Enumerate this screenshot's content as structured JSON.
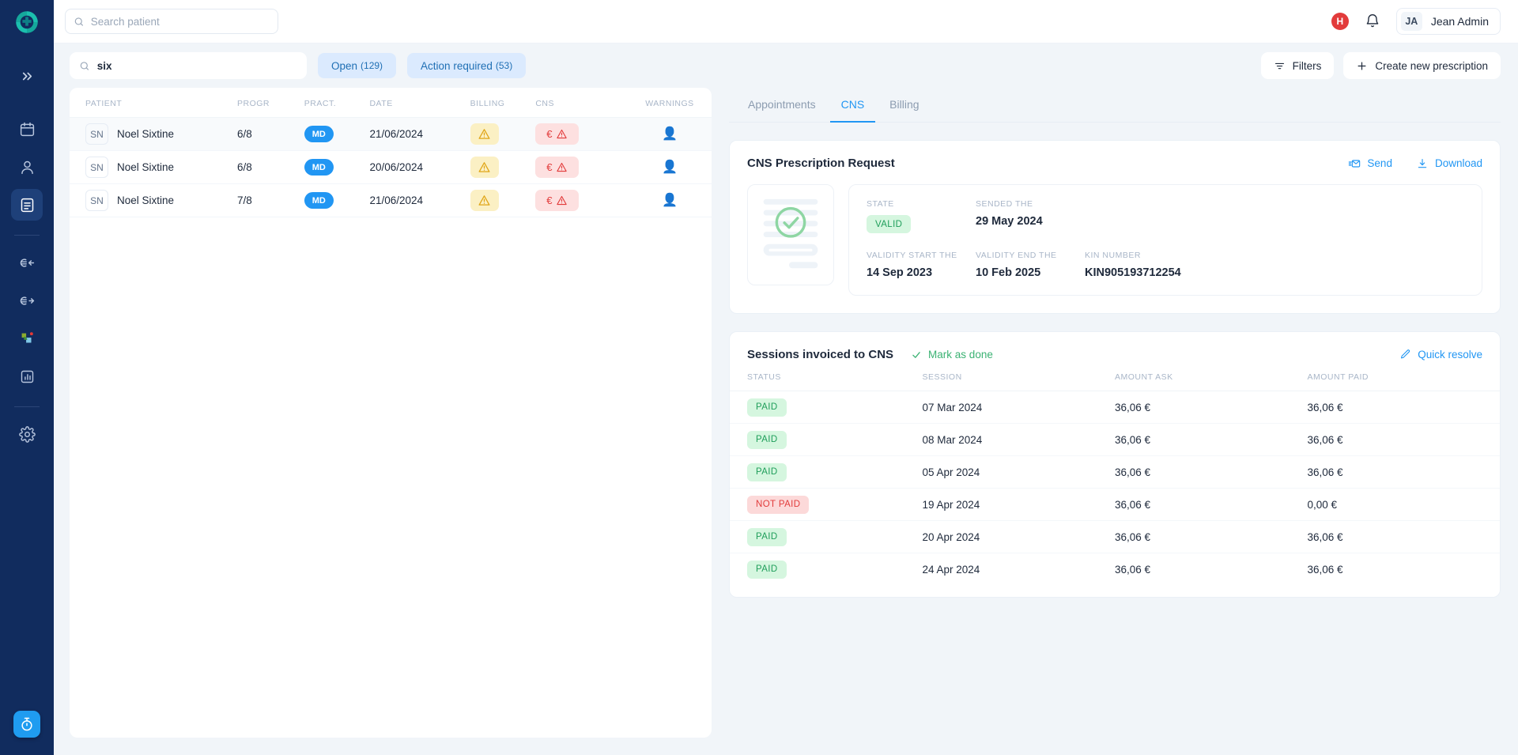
{
  "sidebar": {
    "logo_icon": "medical-cross-logo",
    "collapse_icon": "chevrons-right-icon",
    "items": [
      {
        "name": "calendar",
        "icon": "calendar-icon",
        "active": false
      },
      {
        "name": "patients",
        "icon": "user-icon",
        "active": false
      },
      {
        "name": "prescriptions",
        "icon": "document-lines-icon",
        "active": true
      },
      {
        "name": "incoming-payments",
        "icon": "euro-arrow-left-icon",
        "active": false
      },
      {
        "name": "outgoing-payments",
        "icon": "euro-arrow-right-icon",
        "active": false
      },
      {
        "name": "apps",
        "icon": "colored-shapes-icon",
        "active": false
      },
      {
        "name": "statistics",
        "icon": "bar-chart-icon",
        "active": false
      },
      {
        "name": "settings",
        "icon": "gear-icon",
        "active": false
      }
    ],
    "timer_icon": "stopwatch-icon"
  },
  "topbar": {
    "search_placeholder": "Search patient",
    "search_value": "",
    "search_icon": "search-icon",
    "alert_letter": "H",
    "bell_icon": "bell-icon",
    "user_initials": "JA",
    "user_name": "Jean Admin"
  },
  "subbar": {
    "search_value": "six",
    "search_placeholder": "Search",
    "search_icon": "search-icon",
    "tabs": [
      {
        "label": "Open",
        "count": "(129)"
      },
      {
        "label": "Action required",
        "count": "(53)"
      }
    ],
    "filters_label": "Filters",
    "filters_icon": "filter-icon",
    "create_label": "Create new prescription",
    "create_icon": "plus-icon"
  },
  "patient_table": {
    "headers": [
      "PATIENT",
      "PROGR",
      "PRACT.",
      "DATE",
      "BILLING",
      "CNS",
      "WARNINGS"
    ],
    "rows": [
      {
        "initials": "SN",
        "name": "Noel Sixtine",
        "progr": "6/8",
        "pract": "MD",
        "date": "21/06/2024",
        "billing_icon": "warning-triangle-icon",
        "cns_icon": "euro-warning-icon",
        "warning_icon": "person-warning-icon",
        "active": true
      },
      {
        "initials": "SN",
        "name": "Noel Sixtine",
        "progr": "6/8",
        "pract": "MD",
        "date": "20/06/2024",
        "billing_icon": "warning-triangle-icon",
        "cns_icon": "euro-warning-icon",
        "warning_icon": "person-warning-icon",
        "active": false
      },
      {
        "initials": "SN",
        "name": "Noel Sixtine",
        "progr": "7/8",
        "pract": "MD",
        "date": "21/06/2024",
        "billing_icon": "warning-triangle-icon",
        "cns_icon": "euro-warning-icon",
        "warning_icon": "person-warning-icon",
        "active": false
      }
    ]
  },
  "detail": {
    "tabs": [
      {
        "label": "Appointments",
        "active": false
      },
      {
        "label": "CNS",
        "active": true
      },
      {
        "label": "Billing",
        "active": false
      }
    ],
    "prescription": {
      "title": "CNS Prescription Request",
      "send_label": "Send",
      "send_icon": "send-envelope-icon",
      "download_label": "Download",
      "download_icon": "download-icon",
      "thumbnail_icon": "document-check-icon",
      "state_label": "STATE",
      "state_value": "VALID",
      "sent_label": "SENDED THE",
      "sent_value": "29 May 2024",
      "validity_start_label": "VALIDITY START THE",
      "validity_start_value": "14 Sep 2023",
      "validity_end_label": "VALIDITY END THE",
      "validity_end_value": "10 Feb 2025",
      "kin_label": "KIN NUMBER",
      "kin_value": "KIN905193712254"
    },
    "sessions": {
      "title": "Sessions invoiced to CNS",
      "mark_done_label": "Mark as done",
      "mark_done_icon": "check-icon",
      "quick_resolve_label": "Quick resolve",
      "quick_resolve_icon": "pencil-icon",
      "headers": [
        "STATUS",
        "SESSION",
        "AMOUNT ASK",
        "AMOUNT PAID"
      ],
      "rows": [
        {
          "status": "PAID",
          "paid": true,
          "session": "07 Mar 2024",
          "amount_ask": "36,06 €",
          "amount_paid": "36,06 €"
        },
        {
          "status": "PAID",
          "paid": true,
          "session": "08 Mar 2024",
          "amount_ask": "36,06 €",
          "amount_paid": "36,06 €"
        },
        {
          "status": "PAID",
          "paid": true,
          "session": "05 Apr 2024",
          "amount_ask": "36,06 €",
          "amount_paid": "36,06 €"
        },
        {
          "status": "NOT PAID",
          "paid": false,
          "session": "19 Apr 2024",
          "amount_ask": "36,06 €",
          "amount_paid": "0,00 €"
        },
        {
          "status": "PAID",
          "paid": true,
          "session": "20 Apr 2024",
          "amount_ask": "36,06 €",
          "amount_paid": "36,06 €"
        },
        {
          "status": "PAID",
          "paid": true,
          "session": "24 Apr 2024",
          "amount_ask": "36,06 €",
          "amount_paid": "36,06 €"
        }
      ]
    }
  },
  "colors": {
    "sidebar_bg": "#112c5e",
    "accent_blue": "#2196f3",
    "green": "#1f9e5a",
    "red": "#e23b3b",
    "page_bg": "#f1f5f9"
  }
}
